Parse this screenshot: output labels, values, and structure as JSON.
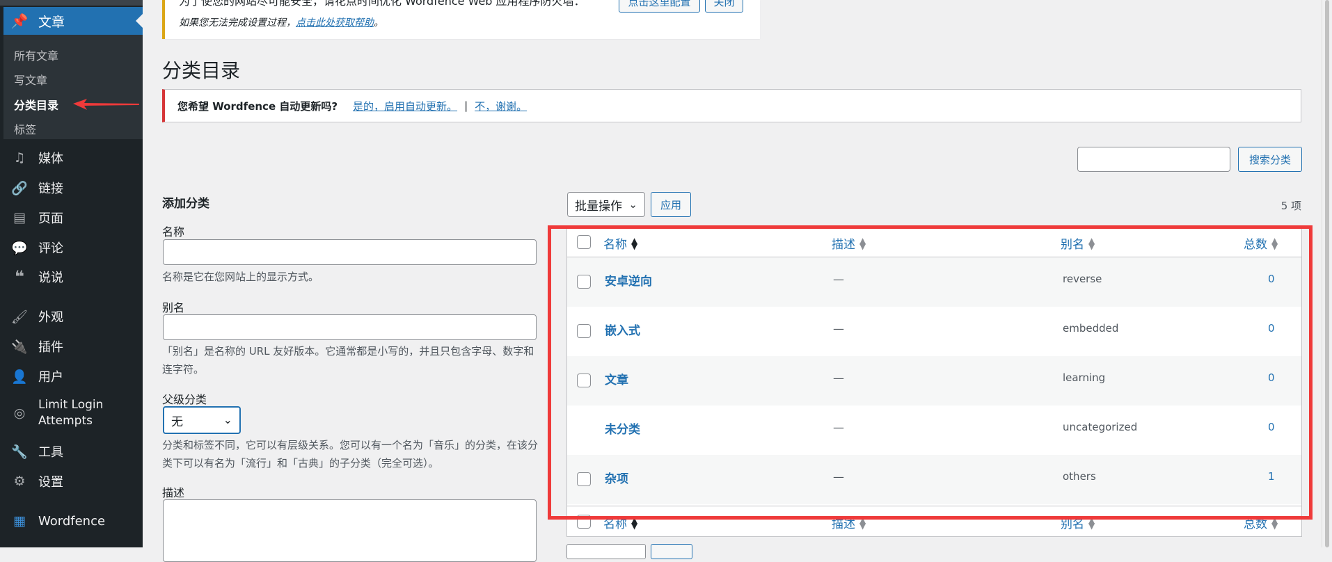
{
  "sidebar": {
    "current_menu": {
      "label": "文章",
      "icon": "pushpin-icon"
    },
    "submenu": [
      "所有文章",
      "写文章",
      "分类目录",
      "标签"
    ],
    "active_submenu": "分类目录",
    "items": [
      {
        "label": "媒体",
        "icon": "media-icon"
      },
      {
        "label": "链接",
        "icon": "link-icon"
      },
      {
        "label": "页面",
        "icon": "page-icon"
      },
      {
        "label": "评论",
        "icon": "comment-icon"
      },
      {
        "label": "说说",
        "icon": "quote-icon"
      },
      {
        "label": "外观",
        "icon": "brush-icon"
      },
      {
        "label": "插件",
        "icon": "plugin-icon"
      },
      {
        "label": "用户",
        "icon": "user-icon"
      },
      {
        "label": "Limit Login Attempts",
        "icon": "fingerprint-icon"
      },
      {
        "label": "工具",
        "icon": "wrench-icon"
      },
      {
        "label": "设置",
        "icon": "settings-icon"
      },
      {
        "label": "Wordfence",
        "icon": "wordfence-icon"
      }
    ]
  },
  "notice_top": {
    "line1": "为了使您的网站尽可能安全，请花点时间优化 Wordfence Web 应用程序防火墙：",
    "line2_prefix": "如果您无法完成设置过程，",
    "line2_link": "点击此处获取帮助",
    "line2_suffix": "。",
    "button_configure": "点击这里配置",
    "button_close": "关闭"
  },
  "page_title": "分类目录",
  "wordfence_notice": {
    "question": "您希望 Wordfence 自动更新吗?",
    "yes_link": "是的，启用自动更新。",
    "separator": "|",
    "no_link": "不，谢谢。"
  },
  "search": {
    "button": "搜索分类",
    "value": ""
  },
  "add_form": {
    "title": "添加分类",
    "name_label": "名称",
    "name_help": "名称是它在您网站上的显示方式。",
    "slug_label": "别名",
    "slug_help": "「别名」是名称的 URL 友好版本。它通常都是小写的，并且只包含字母、数字和连字符。",
    "parent_label": "父级分类",
    "parent_value": "无",
    "parent_help": "分类和标签不同，它可以有层级关系。您可以有一个名为「音乐」的分类，在该分类下可以有名为「流行」和「古典」的子分类（完全可选）。",
    "desc_label": "描述"
  },
  "table": {
    "bulk_actions": "批量操作",
    "apply": "应用",
    "item_count": "5 项",
    "columns": {
      "name": "名称",
      "description": "描述",
      "slug": "别名",
      "count": "总数"
    },
    "rows": [
      {
        "name": "安卓逆向",
        "description": "—",
        "slug": "reverse",
        "count": "0",
        "checkbox": true
      },
      {
        "name": "嵌入式",
        "description": "—",
        "slug": "embedded",
        "count": "0",
        "checkbox": true
      },
      {
        "name": "文章",
        "description": "—",
        "slug": "learning",
        "count": "0",
        "checkbox": true
      },
      {
        "name": "未分类",
        "description": "—",
        "slug": "uncategorized",
        "count": "0",
        "checkbox": false
      },
      {
        "name": "杂项",
        "description": "—",
        "slug": "others",
        "count": "1",
        "checkbox": true
      }
    ]
  },
  "colors": {
    "accent": "#2271b1",
    "sidebar_bg": "#1d2327",
    "highlight": "#ef3a3a",
    "notice_warning": "#dba617",
    "notice_error": "#d63638"
  }
}
